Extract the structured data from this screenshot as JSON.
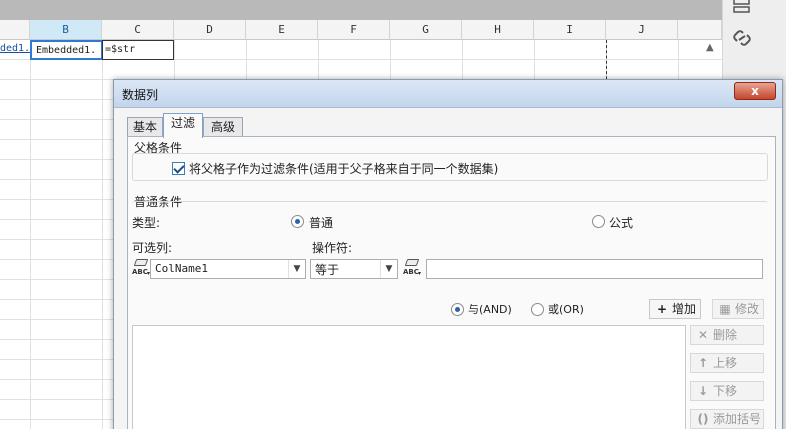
{
  "spreadsheet": {
    "columns": [
      "B",
      "C",
      "D",
      "E",
      "F",
      "G",
      "H",
      "I",
      "J"
    ],
    "selected_column": "B",
    "cells": {
      "a1": "ded1.",
      "b1": "Embedded1.",
      "c1": "=$str"
    }
  },
  "dialog": {
    "title": "数据列",
    "close_label": "x",
    "tabs": [
      {
        "label": "基本",
        "active": false
      },
      {
        "label": "过滤",
        "active": true
      },
      {
        "label": "高级",
        "active": false
      }
    ],
    "parent_condition": {
      "title": "父格条件",
      "checkbox_label": "将父格子作为过滤条件(适用于父子格来自于同一个数据集)",
      "checked": true
    },
    "normal_condition": {
      "title": "普通条件",
      "type_label": "类型:",
      "type_options": [
        {
          "label": "普通",
          "selected": true
        },
        {
          "label": "公式",
          "selected": false
        }
      ],
      "column_label": "可选列:",
      "operator_label": "操作符:",
      "column_value": "ColName1",
      "operator_value": "等于",
      "value_text": ""
    },
    "logic": {
      "and_label": "与(AND)",
      "or_label": "或(OR)",
      "selected": "and"
    },
    "buttons": {
      "add": "增加",
      "modify": "修改",
      "delete": "删除",
      "move_up": "上移",
      "move_down": "下移",
      "add_bracket": "添加括号"
    },
    "icons": {
      "abc": "ABC"
    }
  }
}
